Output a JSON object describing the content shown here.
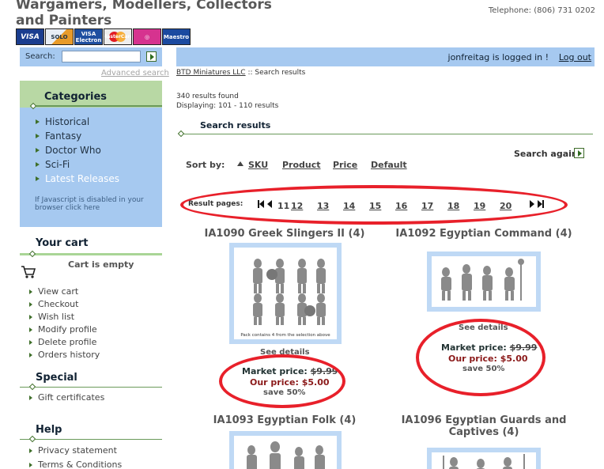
{
  "header": {
    "site_title": "Wargamers, Modellers, Collectors and Painters",
    "telephone": "Telephone: (806) 731 0202",
    "payment_cards": [
      "VISA",
      "SOLO",
      "VISA Electron",
      "MasterCard",
      "JCB",
      "Maestro"
    ]
  },
  "search": {
    "label": "Search:",
    "value": "",
    "advanced": "Advanced search"
  },
  "user_bar": {
    "logged_in": "jonfreitag is logged in !",
    "logout": "Log out"
  },
  "breadcrumb": {
    "home": "BTD Miniatures LLC",
    "separator": "::",
    "current": "Search results"
  },
  "categories": {
    "title": "Categories",
    "items": [
      "Historical",
      "Fantasy",
      "Doctor Who",
      "Sci-Fi",
      "Latest Releases"
    ],
    "js_note": "If Javascript is disabled in your browser click here"
  },
  "cart": {
    "title": "Your cart",
    "empty": "Cart is empty",
    "links": [
      "View cart",
      "Checkout",
      "Wish list",
      "Modify profile",
      "Delete profile",
      "Orders history"
    ]
  },
  "special": {
    "title": "Special",
    "links": [
      "Gift certificates"
    ]
  },
  "help": {
    "title": "Help",
    "links": [
      "Privacy statement",
      "Terms & Conditions"
    ]
  },
  "results": {
    "found": "340 results found",
    "displaying": "Displaying: 101 - 110 results",
    "title": "Search results",
    "search_again": "Search again",
    "sort_by": "Sort by:",
    "sort_options": [
      "SKU",
      "Product",
      "Price",
      "Default"
    ],
    "pages_label": "Result pages:",
    "current_page": "11",
    "pages": [
      "12",
      "13",
      "14",
      "15",
      "16",
      "17",
      "18",
      "19",
      "20"
    ]
  },
  "products": [
    {
      "title": "IA1090 Greek Slingers II (4)",
      "image_caption": "Pack contains 4 from the selection above",
      "see_details": "See details",
      "market_label": "Market price:",
      "market_price": "$9.99",
      "our_label": "Our price:",
      "our_price": "$5.00",
      "save": "save 50%"
    },
    {
      "title": "IA1092 Egyptian Command (4)",
      "see_details": "See details",
      "market_label": "Market price:",
      "market_price": "$9.99",
      "our_label": "Our price:",
      "our_price": "$5.00",
      "save": "save 50%"
    },
    {
      "title": "IA1093 Egyptian Folk (4)"
    },
    {
      "title": "IA1096 Egyptian Guards and Captives (4)"
    }
  ]
}
